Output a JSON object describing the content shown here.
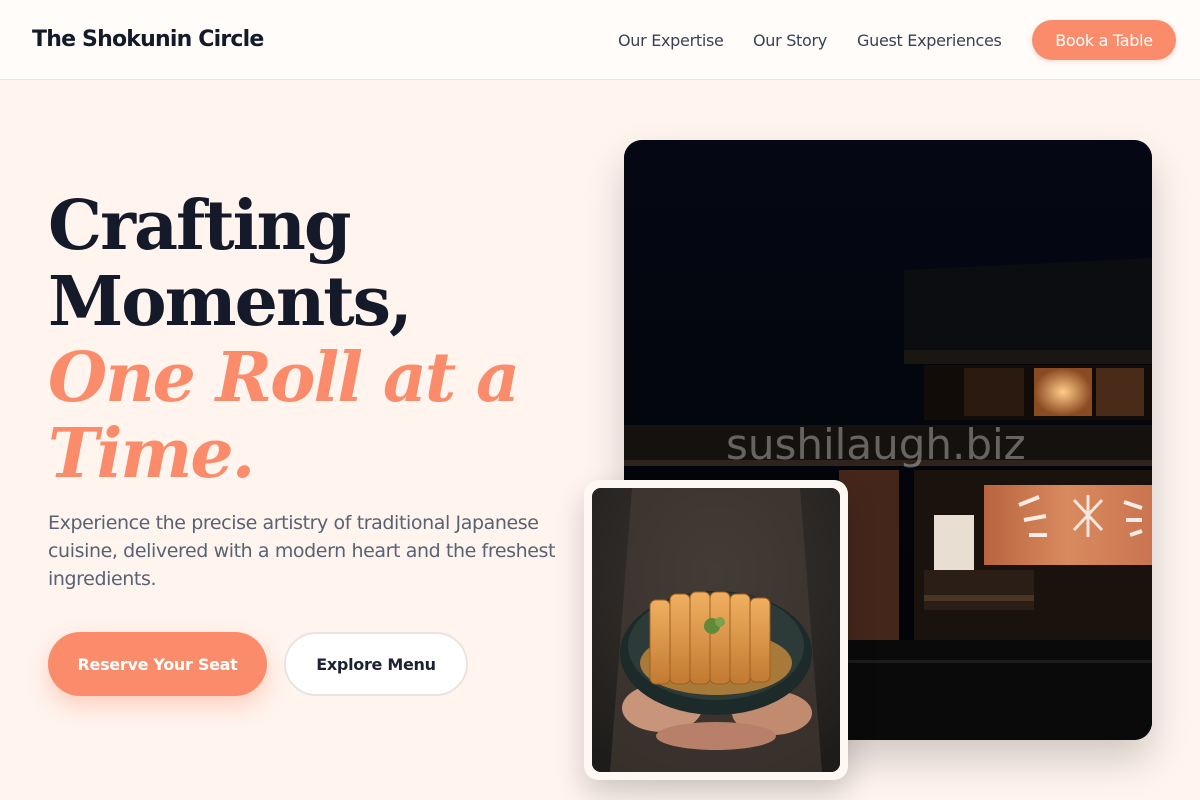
{
  "nav": {
    "brand": "The Shokunin Circle",
    "links": [
      "Our Expertise",
      "Our Story",
      "Guest Experiences"
    ],
    "cta": "Book a Table"
  },
  "hero": {
    "headline_lines": [
      "Crafting",
      "Moments,"
    ],
    "headline_accent_lines": [
      "One Roll at a",
      "Time."
    ],
    "subcopy": "Experience the precise artistry of traditional Japanese cuisine, delivered with a modern heart and the freshest ingredients.",
    "primary_cta": "Reserve Your Seat",
    "secondary_cta": "Explore Menu"
  },
  "media": {
    "watermark": "sushilaugh.biz"
  },
  "colors": {
    "accent": "#fb8c6b",
    "background": "#fff4ee",
    "text_dark": "#141a2a",
    "text_muted": "#596274"
  }
}
